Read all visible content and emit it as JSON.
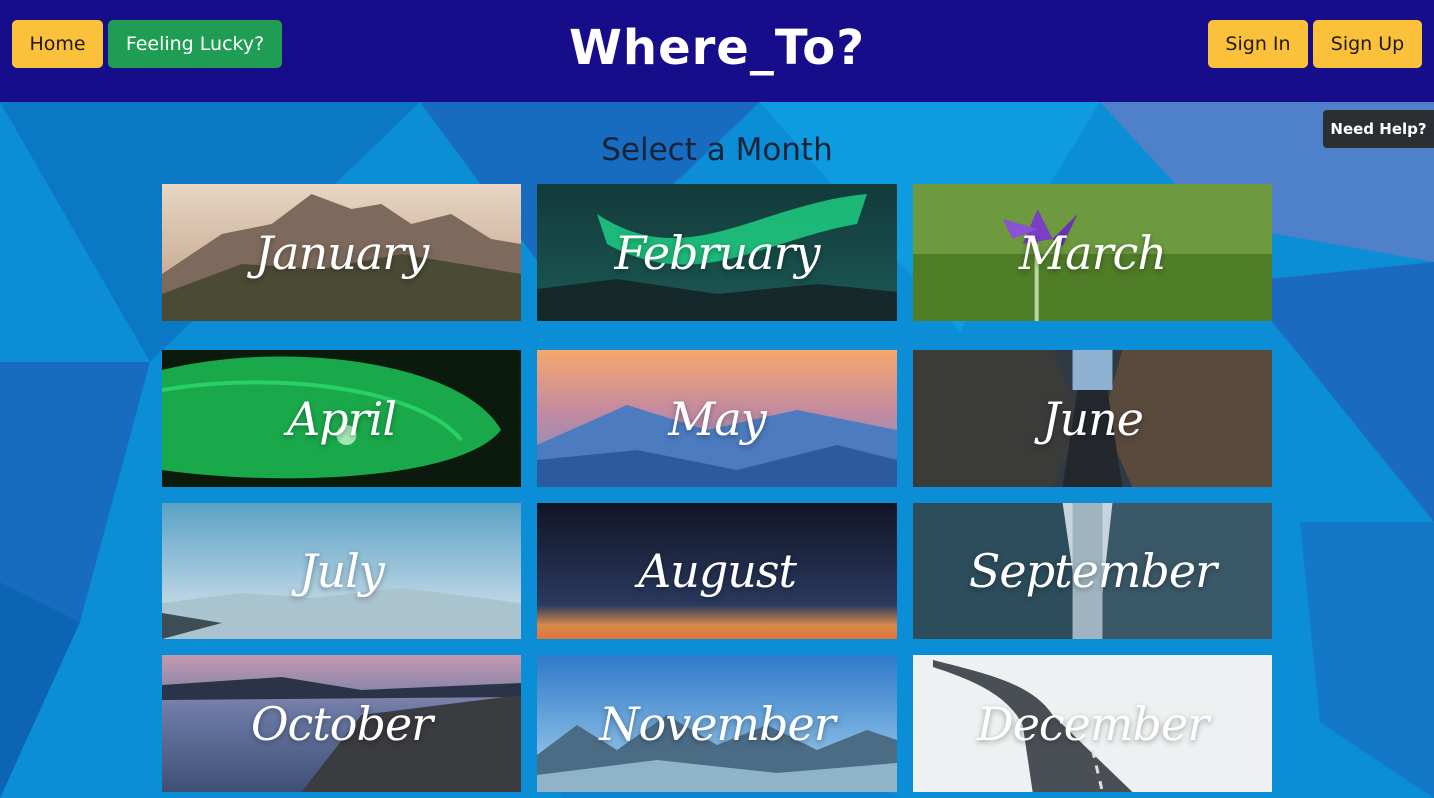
{
  "nav": {
    "home_label": "Home",
    "lucky_label": "Feeling Lucky?",
    "brand": "Where_To?",
    "signin_label": "Sign In",
    "signup_label": "Sign Up"
  },
  "help": {
    "label": "Need Help?"
  },
  "page": {
    "title": "Select a Month"
  },
  "months": [
    {
      "label": "January"
    },
    {
      "label": "February"
    },
    {
      "label": "March"
    },
    {
      "label": "April"
    },
    {
      "label": "May"
    },
    {
      "label": "June"
    },
    {
      "label": "July"
    },
    {
      "label": "August"
    },
    {
      "label": "September"
    },
    {
      "label": "October"
    },
    {
      "label": "November"
    },
    {
      "label": "December"
    }
  ],
  "colors": {
    "navbar": "#170c8a",
    "background": "#0a8fd6",
    "button_yellow": "#fbc13b",
    "button_green": "#1f9d55",
    "help_tab": "#2b2e33"
  }
}
